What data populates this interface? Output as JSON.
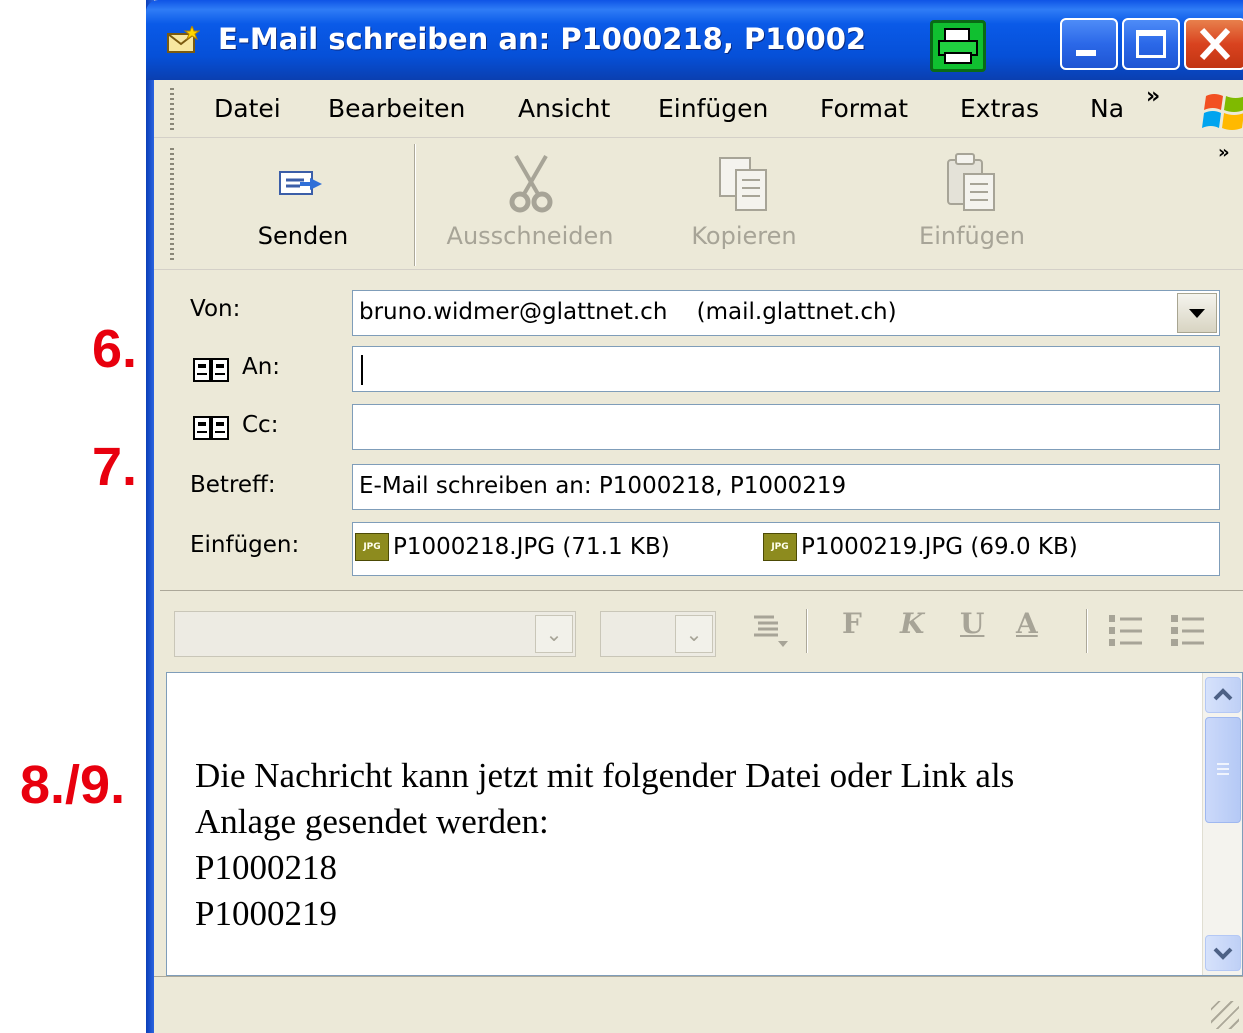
{
  "annotations": [
    "6.",
    "7.",
    "8./9."
  ],
  "window": {
    "title": "E-Mail schreiben an: P1000218, P10002",
    "controls": [
      "minimize",
      "maximize",
      "close"
    ]
  },
  "menu": {
    "items": [
      "Datei",
      "Bearbeiten",
      "Ansicht",
      "Einfügen",
      "Format",
      "Extras",
      "Na"
    ],
    "overflow": "»"
  },
  "toolbar": {
    "overflow": "»",
    "buttons": [
      {
        "label": "Senden",
        "icon": "send-mail-icon",
        "enabled": true
      },
      {
        "label": "Ausschneiden",
        "icon": "scissors-icon",
        "enabled": false
      },
      {
        "label": "Kopieren",
        "icon": "copy-icon",
        "enabled": false
      },
      {
        "label": "Einfügen",
        "icon": "paste-icon",
        "enabled": false
      }
    ]
  },
  "header": {
    "from": {
      "label": "Von:",
      "value": "bruno.widmer@glattnet.ch    (mail.glattnet.ch)"
    },
    "to": {
      "label": "An:",
      "value": ""
    },
    "cc": {
      "label": "Cc:",
      "value": ""
    },
    "subject": {
      "label": "Betreff:",
      "value": "E-Mail schreiben an: P1000218, P1000219"
    },
    "attachments": {
      "label": "Einfügen:",
      "files": [
        "P1000218.JPG (71.1 KB)",
        "P1000219.JPG (69.0 KB)"
      ],
      "icon_text": "JPG"
    }
  },
  "format_toolbar": {
    "buttons": [
      "F",
      "K",
      "U",
      "A"
    ]
  },
  "message": {
    "lines": [
      "Die Nachricht kann jetzt mit folgender Datei oder Link als",
      "Anlage gesendet werden:",
      "P1000218",
      "P1000219"
    ]
  },
  "colors": {
    "annotation": "#e8000e",
    "titlebar": "#0a5ae8",
    "chrome": "#ece9d8",
    "field_border": "#7f9db9"
  }
}
